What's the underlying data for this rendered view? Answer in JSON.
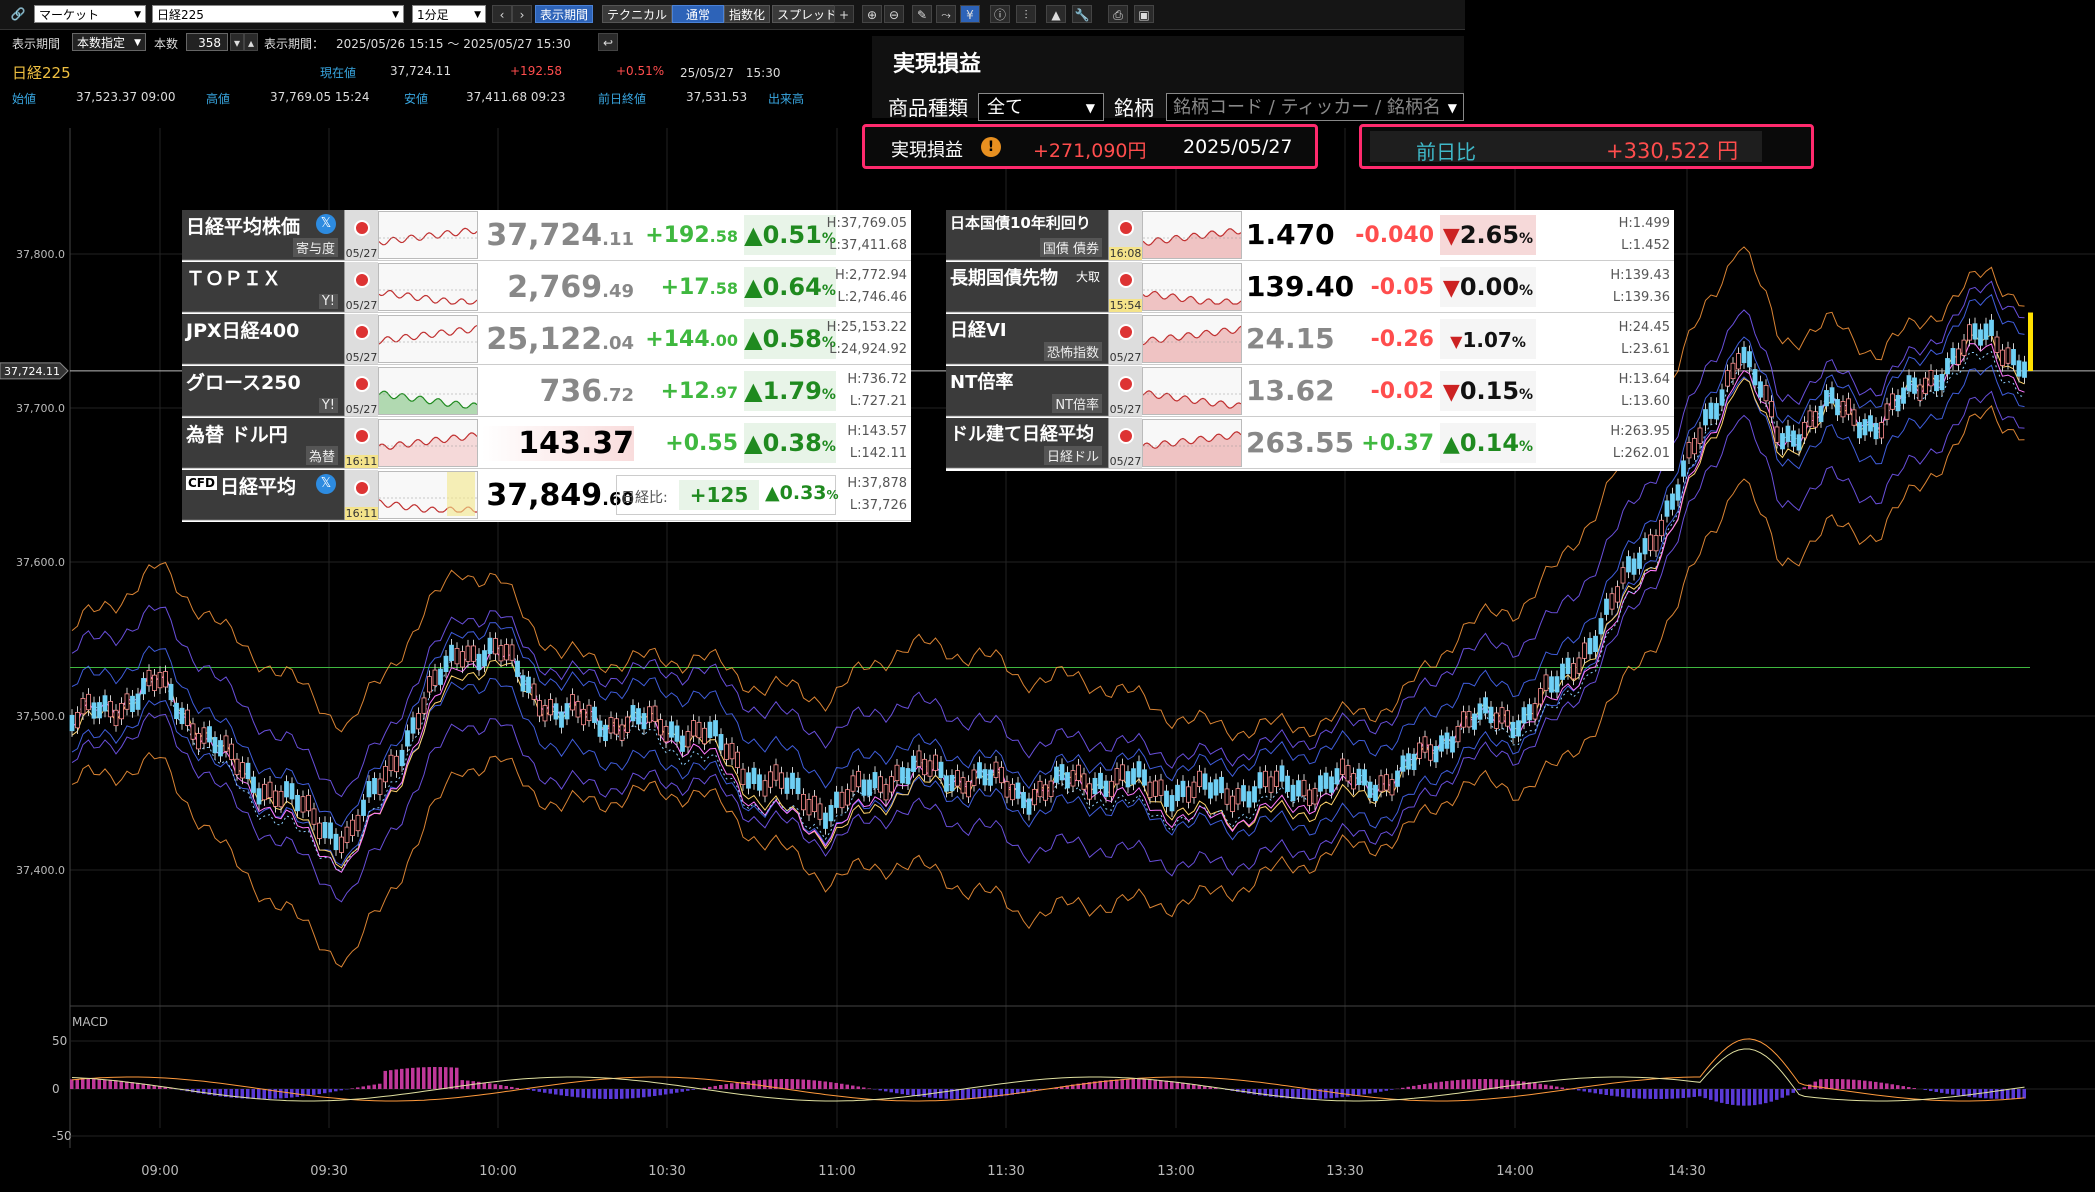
{
  "toolbar": {
    "market_select": "マーケット",
    "symbol_select": "日経225",
    "interval_select": "1分足",
    "btn_period": "表示期間",
    "btn_technical": "テクニカル",
    "btn_normal": "通常",
    "btn_index": "指数化",
    "btn_spread": "スプレッド"
  },
  "period_row": {
    "label_period": "表示期間",
    "mode_select": "本数指定",
    "label_count": "本数",
    "count_value": "358",
    "label_range": "表示期間：",
    "range_value": "2025/05/26 15:15 ～ 2025/05/27 15:30"
  },
  "quote_header": {
    "name": "日経225",
    "current_label": "現在値",
    "current_value": "37,724.11",
    "change": "+192.58",
    "change_pct": "+0.51%",
    "datetime": "25/05/27　15:30",
    "open_label": "始値",
    "open_value": "37,523.37 09:00",
    "high_label": "高値",
    "high_value": "37,769.05 15:24",
    "low_label": "安値",
    "low_value": "37,411.68 09:23",
    "prev_label": "前日終値",
    "prev_value": "37,531.53",
    "volume_label": "出来高"
  },
  "pnl": {
    "title": "実現損益",
    "type_label": "商品種類",
    "type_value": "全て",
    "symbol_label": "銘柄",
    "symbol_placeholder": "銘柄コード / ティッカー / 銘柄名",
    "realized_label": "実現損益",
    "realized_value": "+271,090円",
    "realized_date": "2025/05/27",
    "prev_label": "前日比",
    "prev_value": "+330,522 円"
  },
  "board_left": [
    {
      "name": "日経平均株価",
      "sub": "寄与度",
      "date": "05/27",
      "price_main": "37,724",
      "price_dec": ".11",
      "change_main": "+192",
      "change_dec": ".58",
      "pct": "0.51",
      "dir": "up",
      "high": "H:37,769.05",
      "low": "L:37,411.68"
    },
    {
      "name": "ＴＯＰＩＸ",
      "sub": "Y!",
      "date": "05/27",
      "price_main": "2,769",
      "price_dec": ".49",
      "change_main": "+17",
      "change_dec": ".58",
      "pct": "0.64",
      "dir": "up",
      "high": "H:2,772.94",
      "low": "L:2,746.46"
    },
    {
      "name": "JPX日経400",
      "sub": "",
      "date": "05/27",
      "price_main": "25,122",
      "price_dec": ".04",
      "change_main": "+144",
      "change_dec": ".00",
      "pct": "0.58",
      "dir": "up",
      "high": "H:25,153.22",
      "low": "L:24,924.92"
    },
    {
      "name": "グロース250",
      "sub": "Y!",
      "date": "05/27",
      "price_main": "736",
      "price_dec": ".72",
      "change_main": "+12",
      "change_dec": ".97",
      "pct": "1.79",
      "dir": "up",
      "high": "H:736.72",
      "low": "L:727.21"
    },
    {
      "name": "為替 ドル円",
      "sub": "為替",
      "date": "16:11",
      "price_main": "143.37",
      "price_dec": "",
      "change_main": "+0.55",
      "change_dec": "",
      "pct": "0.38",
      "dir": "up",
      "high": "H:143.57",
      "low": "L:142.11"
    },
    {
      "name": "日経平均",
      "cfd": "CFD",
      "sub": "",
      "date": "16:11",
      "price_main": "37,849",
      "price_dec": ".60",
      "nikkei_label": "日経比:",
      "change_main": "+125",
      "change_dec": "",
      "pct": "0.33",
      "dir": "up",
      "high": "H:37,878",
      "low": "L:37,726"
    }
  ],
  "board_right": [
    {
      "name": "日本国債10年利回り",
      "sub": "国債 債券",
      "date": "16:08",
      "price": "1.470",
      "change": "-0.040",
      "pct": "2.65",
      "dir": "dn",
      "high": "H:1.499",
      "low": "L:1.452"
    },
    {
      "name": "長期国債先物",
      "tag": "大取",
      "sub": "",
      "date": "15:54",
      "price": "139.40",
      "change": "-0.05",
      "pct": "0.00",
      "dir": "dn",
      "high": "H:139.43",
      "low": "L:139.36"
    },
    {
      "name": "日経VI",
      "sub": "恐怖指数",
      "date": "05/27",
      "price": "24.15",
      "change": "-0.26",
      "pct": "1.07",
      "dir": "dn",
      "high": "H:24.45",
      "low": "L:23.61"
    },
    {
      "name": "NT倍率",
      "sub": "NT倍率",
      "date": "05/27",
      "price": "13.62",
      "change": "-0.02",
      "pct": "0.15",
      "dir": "dn",
      "high": "H:13.64",
      "low": "L:13.60"
    },
    {
      "name": "ドル建て日経平均",
      "sub": "日経ドル",
      "date": "05/27",
      "price": "263.55",
      "change": "+0.37",
      "pct": "0.14",
      "dir": "up",
      "high": "H:263.95",
      "low": "L:262.01"
    }
  ],
  "chart": {
    "price_tag": "37,724.11",
    "y_ticks": [
      "37,800.0",
      "37,700.0",
      "37,600.0",
      "37,500.0",
      "37,400.0"
    ],
    "x_ticks": [
      "09:00",
      "09:30",
      "10:00",
      "10:30",
      "11:00",
      "11:30",
      "13:00",
      "13:30",
      "14:00",
      "14:30"
    ],
    "macd_label": "MACD",
    "macd_ticks": [
      "50",
      "0",
      "-50"
    ]
  },
  "colors": {
    "up": "#1f8a1f",
    "down": "#cc2222",
    "accent": "#2d63b8",
    "highlight": "#ff2a6d",
    "candle": "#6fd0f5"
  }
}
